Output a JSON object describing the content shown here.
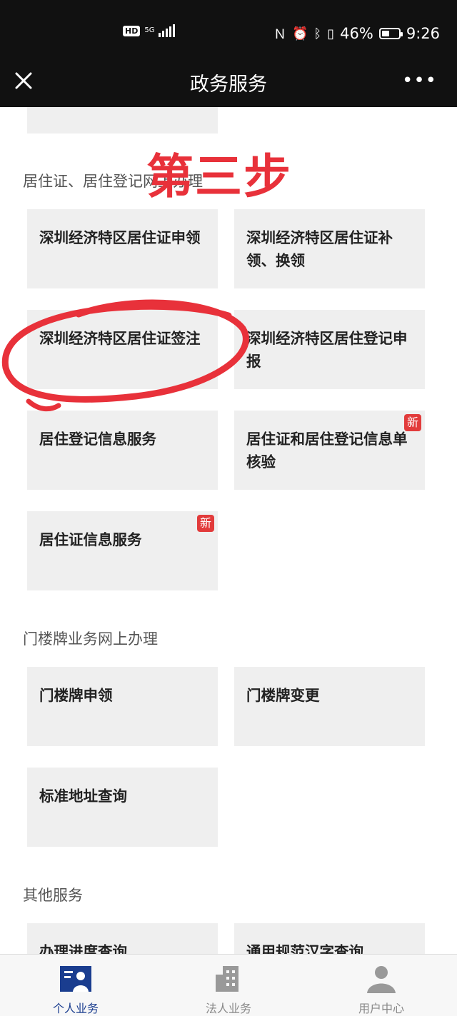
{
  "status_bar": {
    "network": "5G",
    "hd": "HD",
    "battery_pct": "46%",
    "time": "9:26",
    "battery_level": 0.46
  },
  "nav": {
    "title": "政务服务"
  },
  "annotation": {
    "step_text": "第三步",
    "color": "#e8313a"
  },
  "sections": [
    {
      "title": "居住证、居住登记网上办理",
      "tiles": [
        {
          "label": "深圳经济特区居住证申领",
          "badge": ""
        },
        {
          "label": "深圳经济特区居住证补领、换领",
          "badge": ""
        },
        {
          "label": "深圳经济特区居住证签注",
          "badge": ""
        },
        {
          "label": "深圳经济特区居住登记申报",
          "badge": ""
        },
        {
          "label": "居住登记信息服务",
          "badge": ""
        },
        {
          "label": "居住证和居住登记信息单核验",
          "badge": "新"
        },
        {
          "label": "居住证信息服务",
          "badge": "新"
        }
      ]
    },
    {
      "title": "门楼牌业务网上办理",
      "tiles": [
        {
          "label": "门楼牌申领",
          "badge": ""
        },
        {
          "label": "门楼牌变更",
          "badge": ""
        },
        {
          "label": "标准地址查询",
          "badge": ""
        }
      ]
    },
    {
      "title": "其他服务",
      "tiles": [
        {
          "label": "办理进度查询",
          "badge": ""
        },
        {
          "label": "通用规范汉字查询",
          "badge": ""
        }
      ]
    }
  ],
  "tabbar": {
    "tabs": [
      {
        "label": "个人业务",
        "icon": "person-card-icon",
        "active": true
      },
      {
        "label": "法人业务",
        "icon": "building-icon",
        "active": false
      },
      {
        "label": "用户中心",
        "icon": "user-icon",
        "active": false
      }
    ]
  },
  "colors": {
    "accent": "#1a3d8f",
    "badge": "#e23b3b",
    "tile_bg": "#efefef"
  }
}
